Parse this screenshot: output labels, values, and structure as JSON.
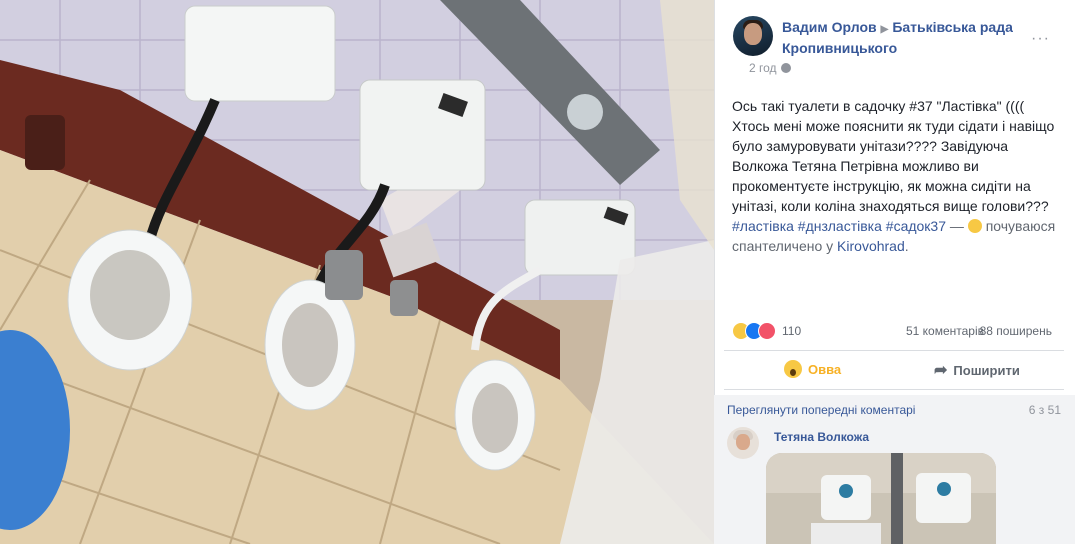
{
  "post": {
    "author": "Вадим Орлов",
    "group": "Батьківська рада Кропивницького",
    "time": "2 год",
    "more_label": "···",
    "text_main": "Ось такі туалети в садочку #37 \"Ластівка\" (((( Хтось мені може пояснити як туди сідати і навіщо було замуровувати унітази???? Завідуюча Волкожа Тетяна Петрівна можливо ви прокоментуєте інструкцію, як можна сидіти на унітазі, коли коліна знаходяться вище голови???",
    "hashtags": "#ластівка #днзластівка #садок37",
    "feeling_prefix": " — ",
    "feeling": "почуваюся спантеличено у ",
    "place": "Kirovohrad",
    "place_suffix": "."
  },
  "stats": {
    "reaction_count": "110",
    "comments": "51 коментарів",
    "shares": "88 поширень"
  },
  "actions": {
    "wow_label": "Овва",
    "share_label": "Поширити"
  },
  "comments": {
    "prev_label": "Переглянути попередні коментарі",
    "count": "6 з 51",
    "first_author": "Тетяна Волкожа"
  },
  "colors": {
    "link": "#385898",
    "text": "#1d2129",
    "muted": "#90949c",
    "wow": "#f7b125"
  },
  "icons": [
    "globe-icon",
    "more-icon",
    "wow-icon",
    "like-icon",
    "angry-icon",
    "share-icon",
    "confused-emoji-icon"
  ]
}
